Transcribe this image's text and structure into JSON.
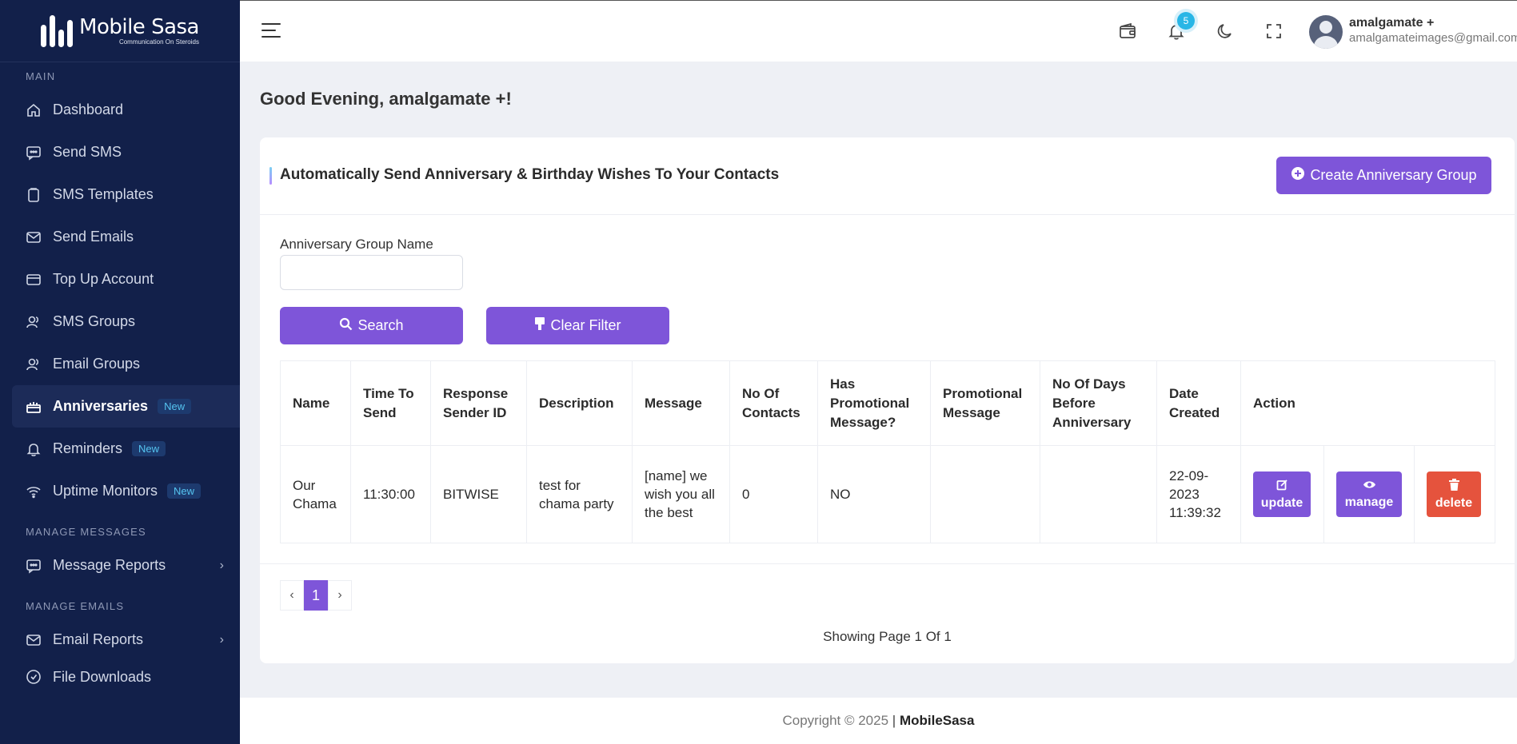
{
  "brand": {
    "name": "Mobile Sasa",
    "tagline": "Communication On Steroids"
  },
  "sidebar": {
    "sections": [
      {
        "label": "MAIN"
      },
      {
        "label": "MANAGE MESSAGES"
      },
      {
        "label": "MANAGE EMAILS"
      }
    ],
    "items": [
      {
        "label": "Dashboard",
        "icon": "home-icon"
      },
      {
        "label": "Send SMS",
        "icon": "message-icon"
      },
      {
        "label": "SMS Templates",
        "icon": "clipboard-icon"
      },
      {
        "label": "Send Emails",
        "icon": "mail-icon"
      },
      {
        "label": "Top Up Account",
        "icon": "card-icon"
      },
      {
        "label": "SMS Groups",
        "icon": "users-icon"
      },
      {
        "label": "Email Groups",
        "icon": "users-icon"
      },
      {
        "label": "Anniversaries",
        "icon": "gift-icon",
        "badge": "New",
        "active": true
      },
      {
        "label": "Reminders",
        "icon": "bell-icon",
        "badge": "New"
      },
      {
        "label": "Uptime Monitors",
        "icon": "wifi-icon",
        "badge": "New"
      },
      {
        "label": "Message Reports",
        "icon": "message-icon"
      },
      {
        "label": "Email Reports",
        "icon": "mail-icon"
      },
      {
        "label": "File Downloads",
        "icon": "download-icon"
      }
    ]
  },
  "header": {
    "notification_count": "5",
    "user_name": "amalgamate +",
    "user_email": "amalgamateimages@gmail.com"
  },
  "main": {
    "greeting": "Good Evening, amalgamate +!",
    "card_title": "Automatically Send Anniversary & Birthday Wishes To Your Contacts",
    "create_button": "Create Anniversary Group",
    "filter_label": "Anniversary Group Name",
    "filter_value": "",
    "search_button": "Search",
    "clear_button": "Clear Filter",
    "table": {
      "headers": [
        "Name",
        "Time To Send",
        "Response Sender ID",
        "Description",
        "Message",
        "No Of Contacts",
        "Has Promotional Message?",
        "Promotional Message",
        "No Of Days Before Anniversary",
        "Date Created",
        "Action"
      ],
      "rows": [
        {
          "name": "Our Chama",
          "time": "11:30:00",
          "sender": "BITWISE",
          "description": "test for chama party",
          "message": "[name] we wish you all the best",
          "contacts": "0",
          "has_promo": "NO",
          "promo_message": "",
          "days_before": "",
          "date_created": "22-09-2023 11:39:32",
          "actions": [
            "update",
            "manage",
            "delete"
          ]
        }
      ]
    },
    "pagination": {
      "prev": "‹",
      "current": "1",
      "next": "›",
      "info": "Showing Page 1 Of 1"
    }
  },
  "footer": {
    "copyright": "Copyright © 2025",
    "brand": "MobileSasa"
  },
  "colors": {
    "sidebar": "#12204a",
    "accent": "#7e55d9",
    "danger": "#e5533d",
    "info": "#29b6e6"
  }
}
